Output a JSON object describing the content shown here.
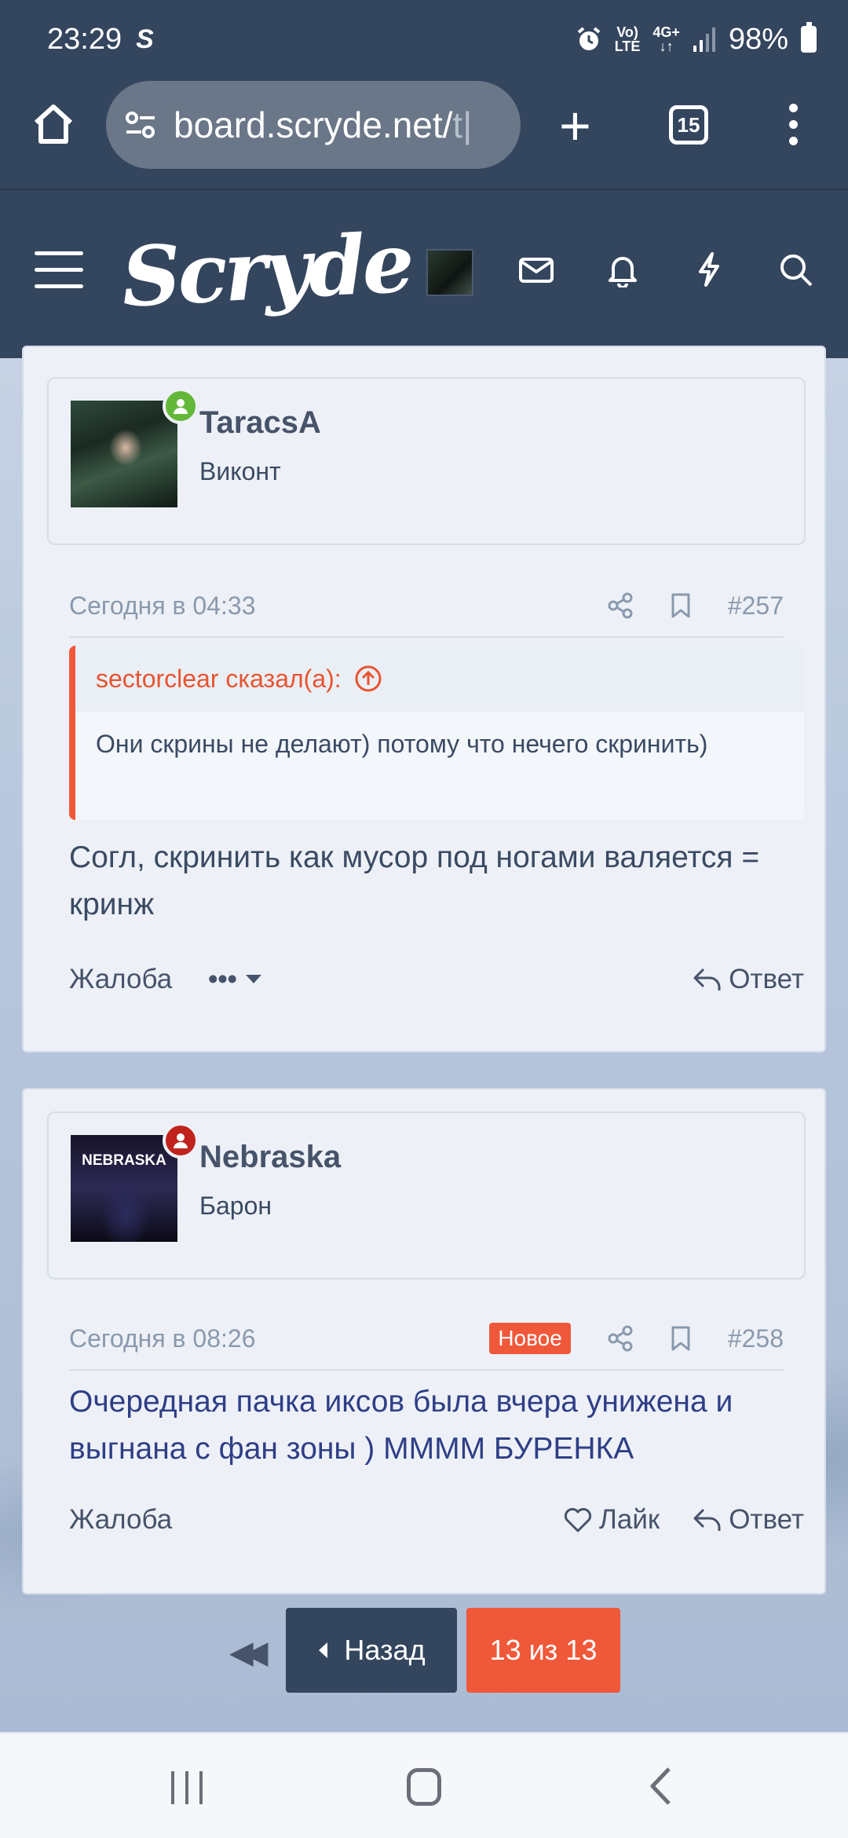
{
  "status_bar": {
    "time": "23:29",
    "app_glyph": "S",
    "net_top": "Vo)",
    "net_bottom": "LTE",
    "net2_top": "4G+",
    "net2_bottom": "↓↑",
    "battery": "98%"
  },
  "browser": {
    "url_main": "board.scryde.net/",
    "url_faded": "t|",
    "tab_count": "15"
  },
  "site": {
    "logo": "Scryde"
  },
  "posts": [
    {
      "username": "TaracsA",
      "user_title": "Виконт",
      "status": "online",
      "status_color": "#63b83a",
      "timestamp": "Сегодня в 04:33",
      "post_number": "#257",
      "quote": {
        "author": "sectorclear сказал(а):",
        "text": "Они скрины не делают) потому что нечего скринить)"
      },
      "message": "Согл, скринить как мусор под ногами валяется = кринж",
      "actions": {
        "report": "Жалоба",
        "more": "•••",
        "reply": "Ответ"
      }
    },
    {
      "username": "Nebraska",
      "user_title": "Барон",
      "avatar_text": "NEBRASKA",
      "status_color": "#c0241d",
      "timestamp": "Сегодня в 08:26",
      "badge": "Новое",
      "post_number": "#258",
      "message": "Очередная пачка иксов была вчера унижена и выгнана с фан зоны ) ММММ БУРЕНКА",
      "actions": {
        "report": "Жалоба",
        "like": "Лайк",
        "reply": "Ответ"
      }
    }
  ],
  "pagination": {
    "first": "◀◀",
    "back": "Назад",
    "current": "13 из 13"
  },
  "colors": {
    "header_bg": "#34455e",
    "accent": "#f0583a"
  }
}
